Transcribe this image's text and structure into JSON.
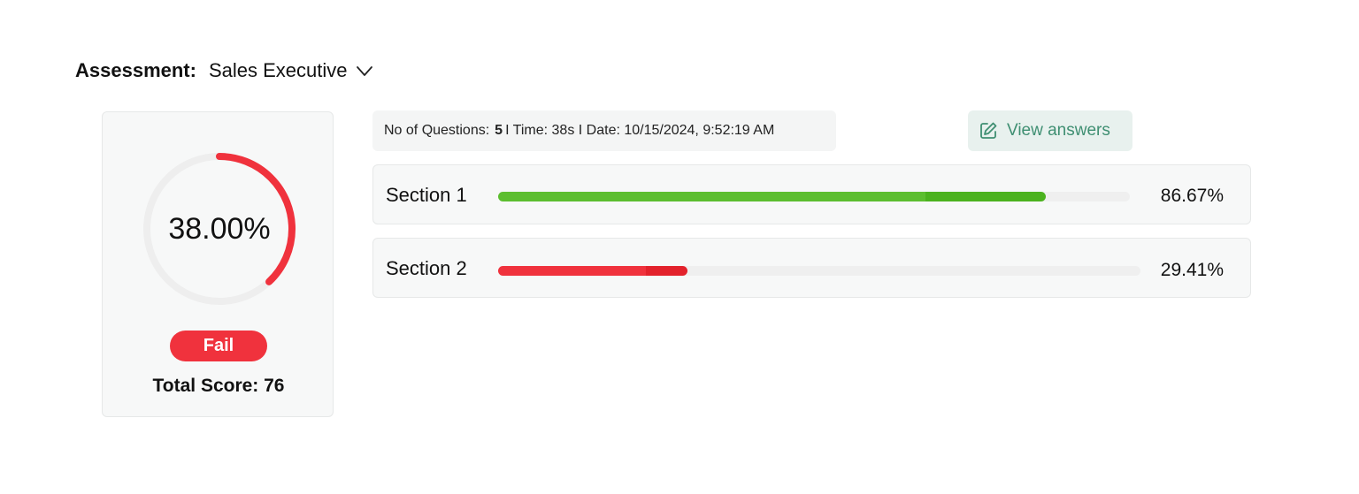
{
  "header": {
    "label": "Assessment:",
    "selected": "Sales Executive",
    "dropdown_icon": "chevron-down-icon"
  },
  "score_card": {
    "percent_text": "38.00%",
    "percent_value": 38.0,
    "status": "Fail",
    "total_score": "Total Score: 76",
    "colors": {
      "ring": "#f0323d",
      "track": "#eeeeee",
      "badge": "#f0323d"
    }
  },
  "meta": {
    "questions_label": "No of Questions:",
    "questions_value": "5",
    "time_text": "I Time: 38s I Date: 10/15/2024, 9:52:19 AM"
  },
  "view_answers": {
    "label": "View answers",
    "icon": "edit-icon",
    "color": "#3f8f72"
  },
  "sections": [
    {
      "name": "Section 1",
      "percent_text": "86.67%",
      "percent_value": 86.67,
      "color": "#5cbe2f",
      "color_dark": "#4bb21e"
    },
    {
      "name": "Section 2",
      "percent_text": "29.41%",
      "percent_value": 29.41,
      "color": "#f0323d",
      "color_dark": "#e3222c"
    }
  ]
}
